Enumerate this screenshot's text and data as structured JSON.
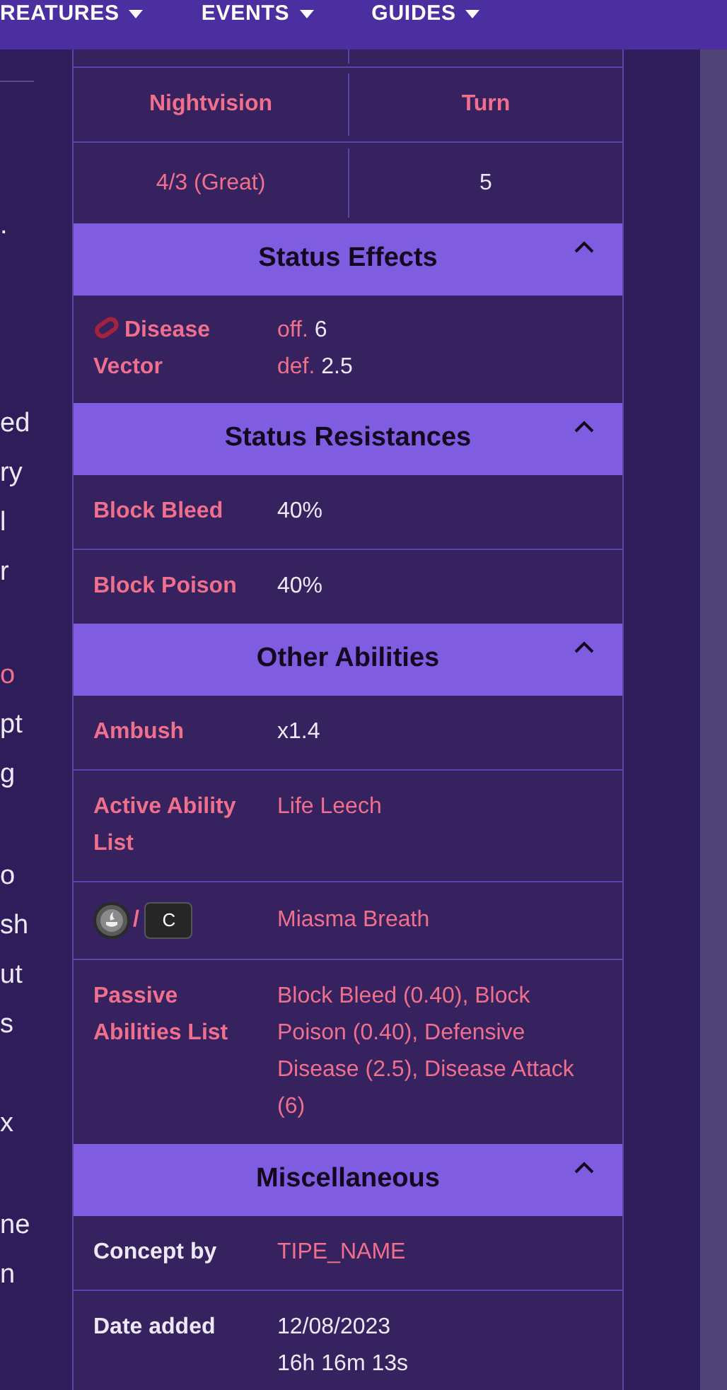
{
  "nav": [
    {
      "label": "REATURES"
    },
    {
      "label": "EVENTS"
    },
    {
      "label": "GUIDES"
    }
  ],
  "side_fragments": [
    {
      "lines": [
        "."
      ],
      "accent": false
    },
    {
      "lines": [
        "ed",
        "ry",
        "l",
        "r"
      ],
      "accent": false
    },
    {
      "lines": [
        "o"
      ],
      "accent": true
    },
    {
      "lines": [
        "pt",
        "g"
      ],
      "accent": false
    },
    {
      "lines": [
        "o",
        "sh",
        "ut",
        "s"
      ],
      "accent": false
    },
    {
      "lines": [
        "x"
      ],
      "accent": false
    },
    {
      "lines": [
        "ne",
        "n"
      ],
      "accent": false
    }
  ],
  "stats_table": {
    "columns": [
      "Nightvision",
      "Turn"
    ],
    "values": [
      "4/3 (Great)",
      "5"
    ]
  },
  "sections": [
    {
      "title": "Status Effects",
      "expanded": true,
      "rows": [
        {
          "kind": "effect",
          "label": "Disease Vector",
          "lines": [
            {
              "prefix": "off.",
              "value": "6"
            },
            {
              "prefix": "def.",
              "value": "2.5"
            }
          ]
        }
      ]
    },
    {
      "title": "Status Resistances",
      "expanded": true,
      "rows": [
        {
          "kind": "text",
          "label": "Block Bleed",
          "label_accent": true,
          "value": "40%",
          "value_accent": false
        },
        {
          "kind": "text",
          "label": "Block Poison",
          "label_accent": true,
          "value": "40%",
          "value_accent": false
        }
      ]
    },
    {
      "title": "Other Abilities",
      "expanded": true,
      "rows": [
        {
          "kind": "text",
          "label": "Ambush",
          "label_accent": true,
          "value": "x1.4",
          "value_accent": false
        },
        {
          "kind": "text",
          "label": "Active Ability List",
          "label_accent": true,
          "value": "Life Leech",
          "value_accent": true
        },
        {
          "kind": "keys",
          "separator": "/",
          "key": "C",
          "value": "Miasma Breath",
          "value_accent": true
        },
        {
          "kind": "text",
          "label": "Passive Abilities List",
          "label_accent": true,
          "value": "Block Bleed (0.40), Block Poison (0.40), Defensive Disease (2.5), Disease Attack (6)",
          "value_accent": true
        }
      ]
    },
    {
      "title": "Miscellaneous",
      "expanded": true,
      "rows": [
        {
          "kind": "text",
          "label": "Concept by",
          "label_accent": false,
          "value": "TIPE_NAME",
          "value_accent": true
        },
        {
          "kind": "text",
          "label": "Date added",
          "label_accent": false,
          "value_lines": [
            "12/08/2023",
            "16h 16m 13s"
          ],
          "value_accent": false
        }
      ]
    }
  ]
}
